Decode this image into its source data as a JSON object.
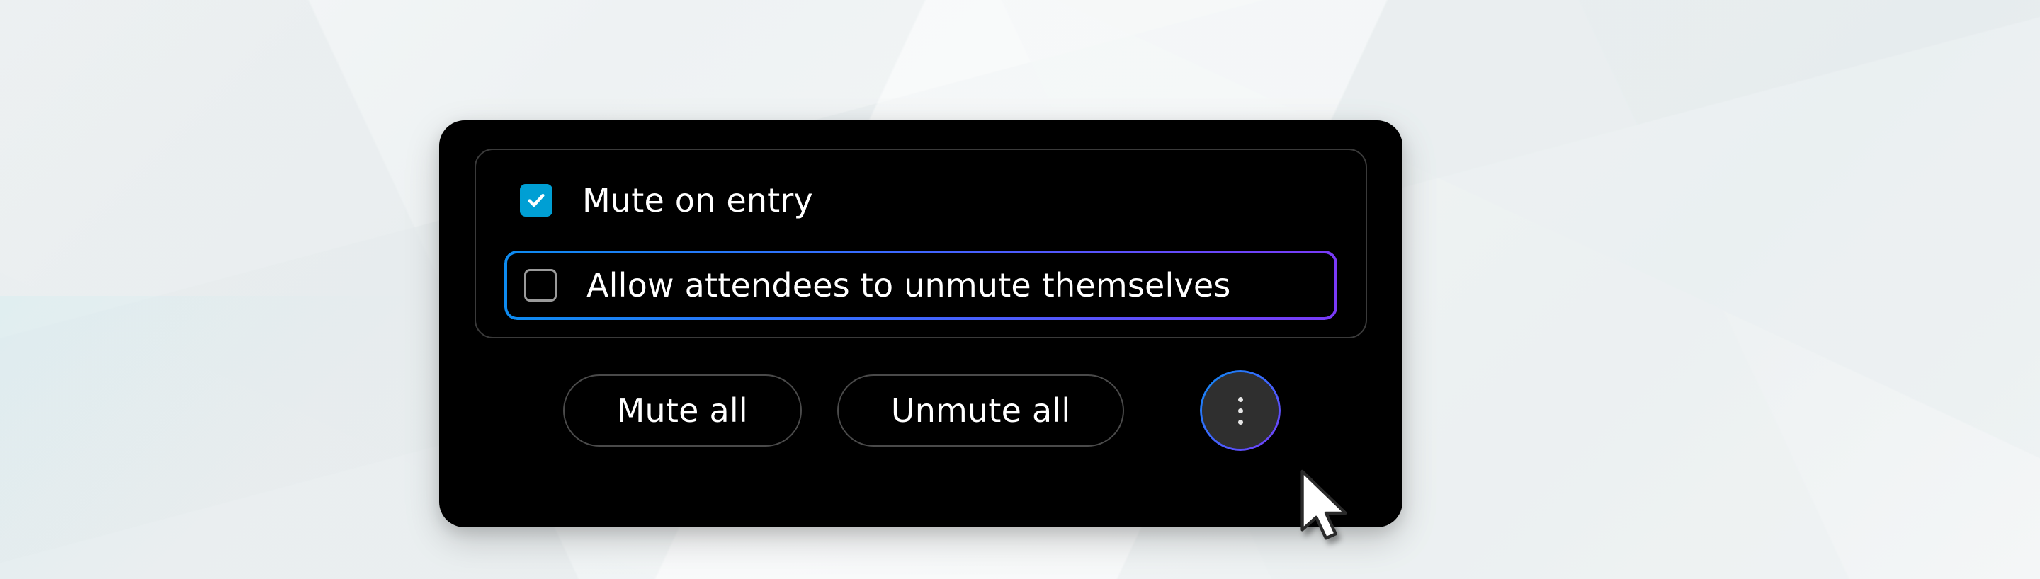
{
  "popup": {
    "options": [
      {
        "checked": true,
        "highlighted": false,
        "label": "Mute  on entry"
      },
      {
        "checked": false,
        "highlighted": true,
        "label": "Allow attendees to unmute themselves"
      }
    ],
    "buttons": {
      "mute_all": "Mute all",
      "unmute_all": "Unmute all"
    }
  },
  "colors": {
    "accent_checkbox": "#009fd4",
    "gradient_start": "#0d8bf0",
    "gradient_end": "#7a3af7",
    "panel_bg": "#000000"
  }
}
